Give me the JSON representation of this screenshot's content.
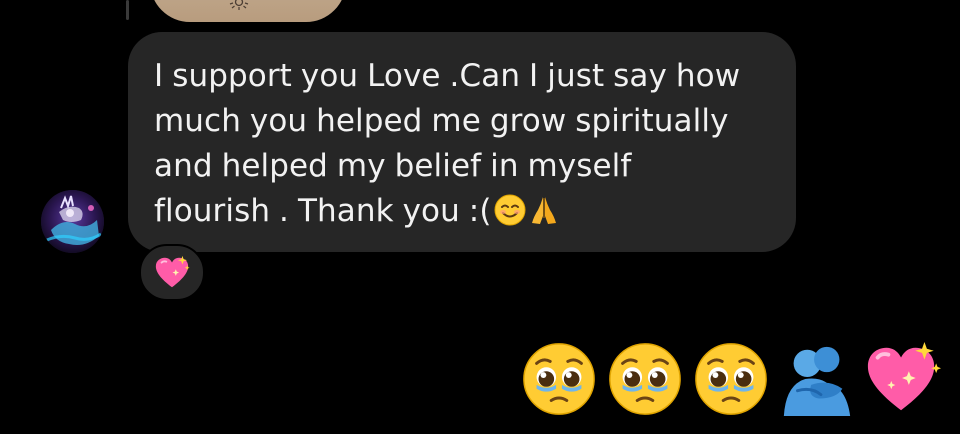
{
  "message": {
    "line1": "I support you Love .Can I just say how",
    "line2": "much you helped me grow spiritually",
    "line3": "and helped my belief in myself",
    "line4": "flourish . Thank you :("
  },
  "reaction": {
    "emoji": "sparkling-heart"
  },
  "emoji_row": [
    "pleading-face",
    "pleading-face",
    "pleading-face",
    "people-hugging",
    "sparkling-heart"
  ],
  "colors": {
    "background": "#000000",
    "bubble": "#262626",
    "text": "#f2f2f2"
  }
}
